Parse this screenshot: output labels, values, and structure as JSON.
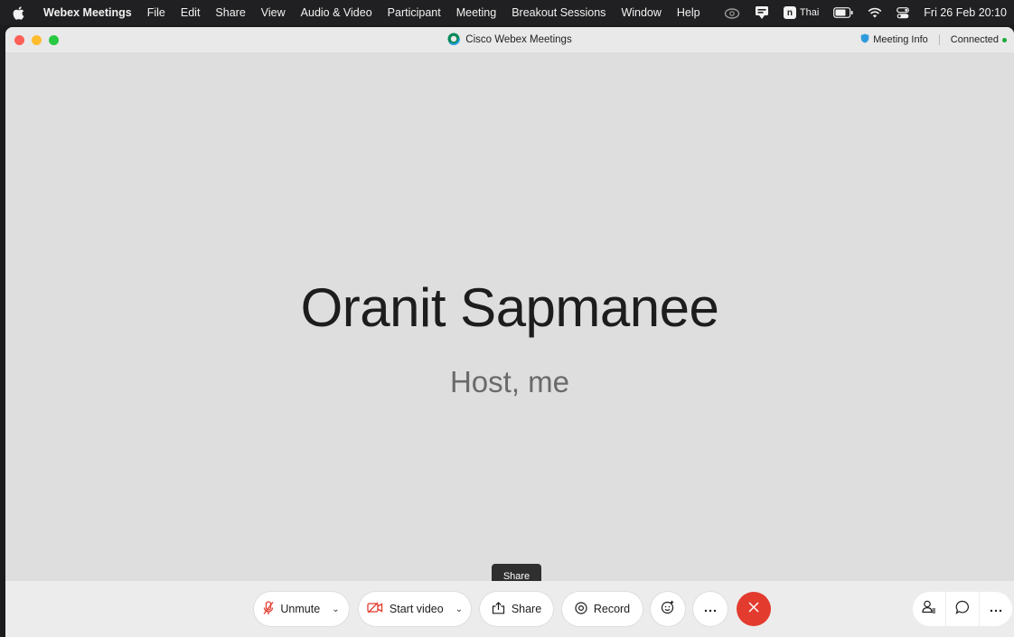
{
  "menubar": {
    "app_name": "Webex Meetings",
    "items": [
      "File",
      "Edit",
      "Share",
      "View",
      "Audio & Video",
      "Participant",
      "Meeting",
      "Breakout Sessions",
      "Window",
      "Help"
    ],
    "input_source": "Thai",
    "input_source_badge": "n",
    "clock": "Fri 26 Feb  20:10"
  },
  "window": {
    "title": "Cisco Webex Meetings",
    "meeting_info_label": "Meeting Info",
    "connection_status": "Connected"
  },
  "stage": {
    "participant_name": "Oranit Sapmanee",
    "participant_role": "Host, me"
  },
  "tooltip": {
    "text": "Share"
  },
  "controls": {
    "unmute_label": "Unmute",
    "start_video_label": "Start video",
    "share_label": "Share",
    "record_label": "Record"
  },
  "colors": {
    "end_meeting": "#e33b2e",
    "muted_icon": "#e33b2e",
    "connected_dot": "#1fa83a",
    "meeting_info_icon": "#2f9bdc"
  }
}
